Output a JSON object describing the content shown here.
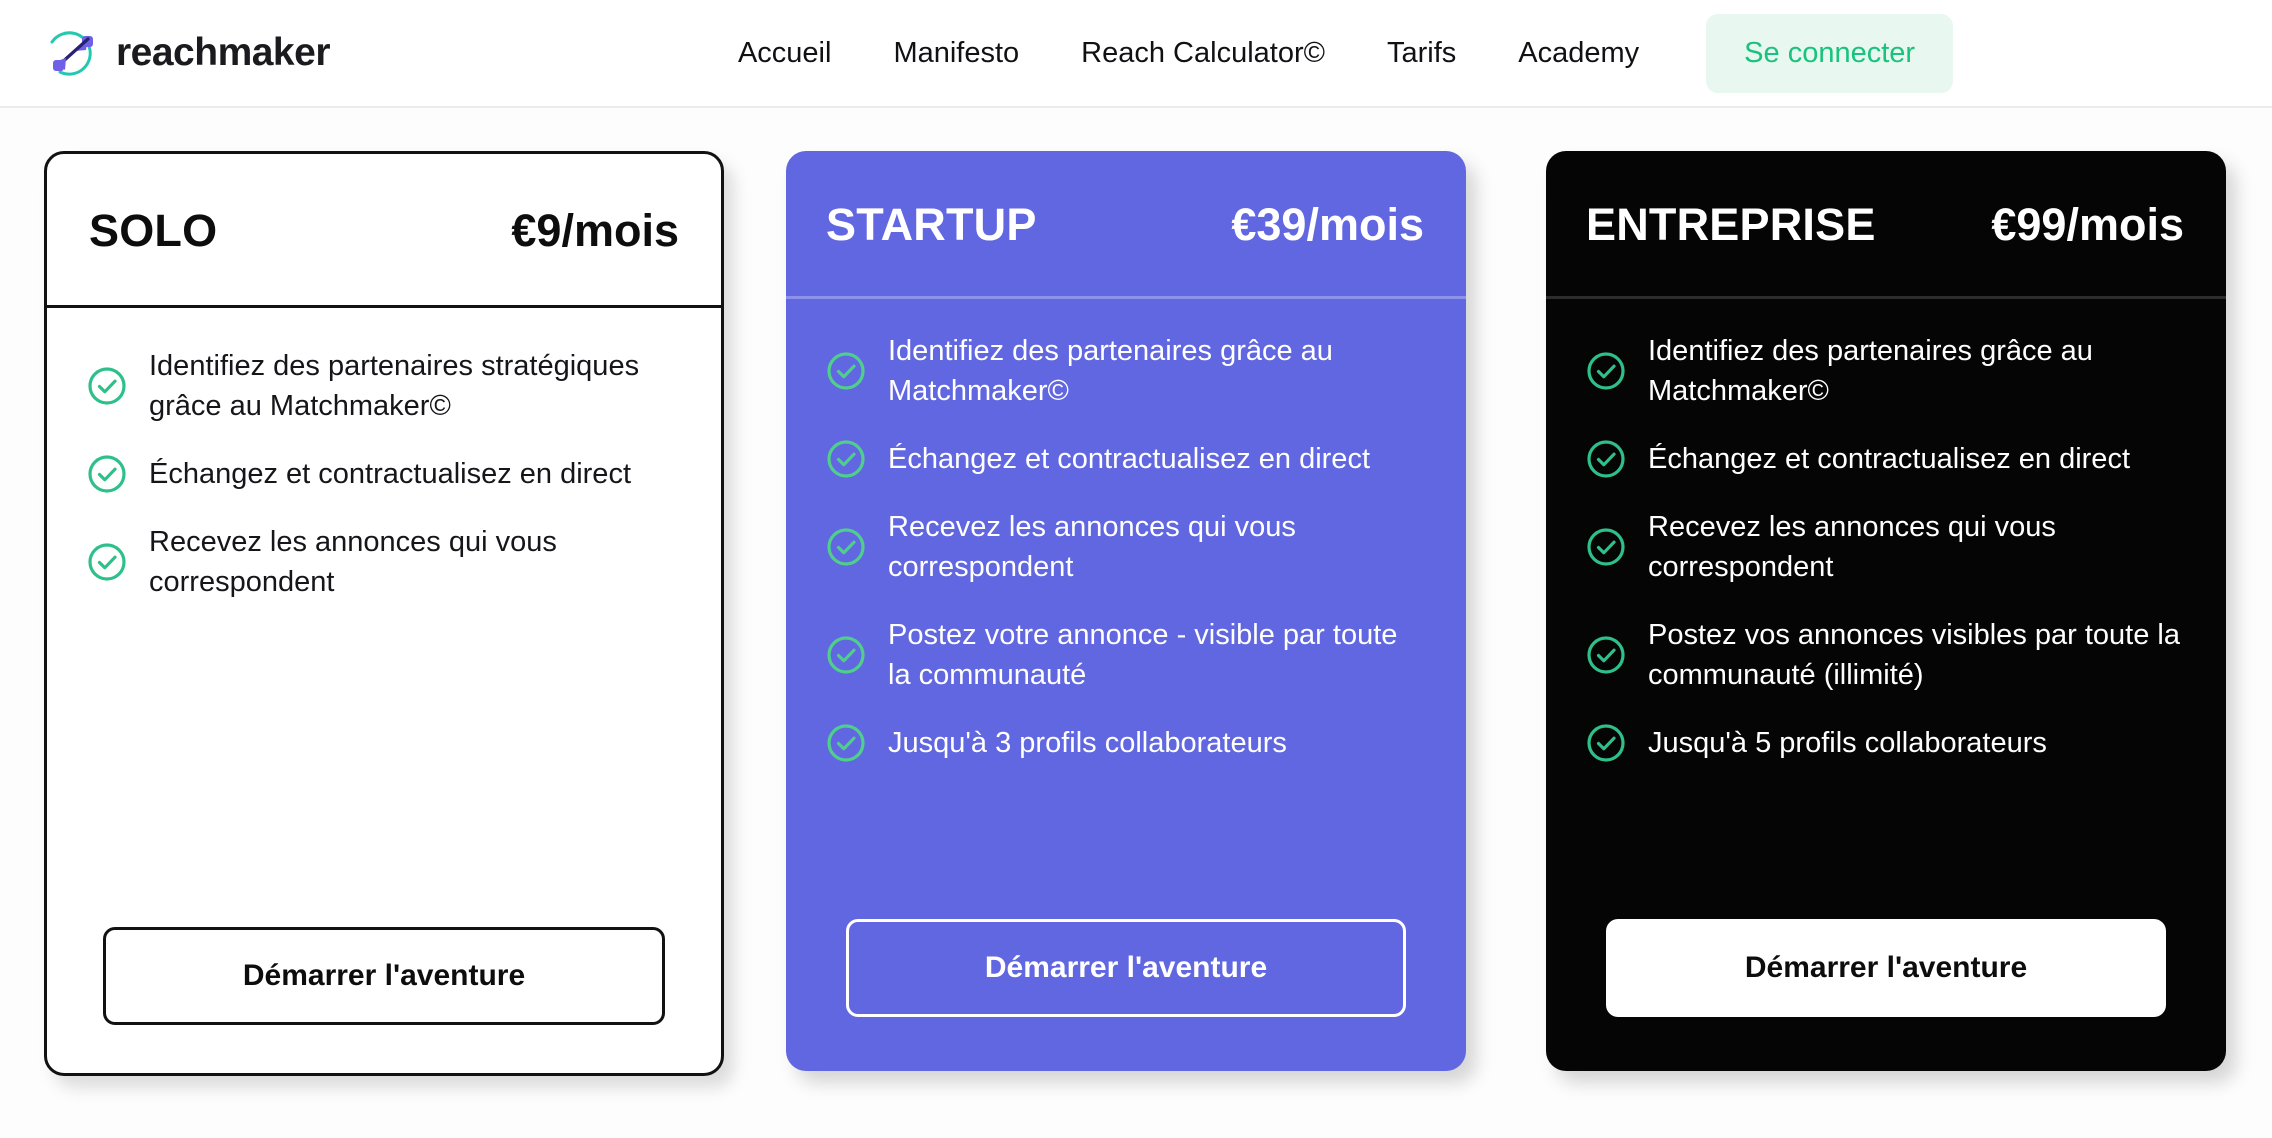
{
  "brand": {
    "name": "reachmaker",
    "icon": "arrow-target-logo-icon"
  },
  "nav": {
    "links": [
      {
        "label": "Accueil"
      },
      {
        "label": "Manifesto"
      },
      {
        "label": "Reach Calculator©"
      },
      {
        "label": "Tarifs"
      },
      {
        "label": "Academy"
      }
    ],
    "login_label": "Se connecter"
  },
  "colors": {
    "accent_purple": "#6167e0",
    "accent_green": "#19c37d",
    "dark": "#050505",
    "login_bg": "#e8f7ef"
  },
  "plans": [
    {
      "name": "SOLO",
      "price": "€9/mois",
      "features": [
        "Identifiez des partenaires stratégiques grâce au Matchmaker©",
        "Échangez et contractualisez en direct",
        "Recevez les annonces qui vous correspondent"
      ],
      "cta_label": "Démarrer l'aventure"
    },
    {
      "name": "STARTUP",
      "price": "€39/mois",
      "features": [
        "Identifiez des partenaires grâce au Matchmaker©",
        "Échangez et contractualisez en direct",
        "Recevez les annonces qui vous correspondent",
        "Postez votre annonce - visible par toute la communauté",
        "Jusqu'à 3 profils collaborateurs"
      ],
      "cta_label": "Démarrer l'aventure"
    },
    {
      "name": "ENTREPRISE",
      "price": "€99/mois",
      "features": [
        "Identifiez des partenaires grâce au Matchmaker©",
        "Échangez et contractualisez en direct",
        "Recevez les annonces qui vous correspondent",
        "Postez vos annonces visibles par toute la communauté (illimité)",
        "Jusqu'à 5 profils collaborateurs"
      ],
      "cta_label": "Démarrer l'aventure"
    }
  ]
}
